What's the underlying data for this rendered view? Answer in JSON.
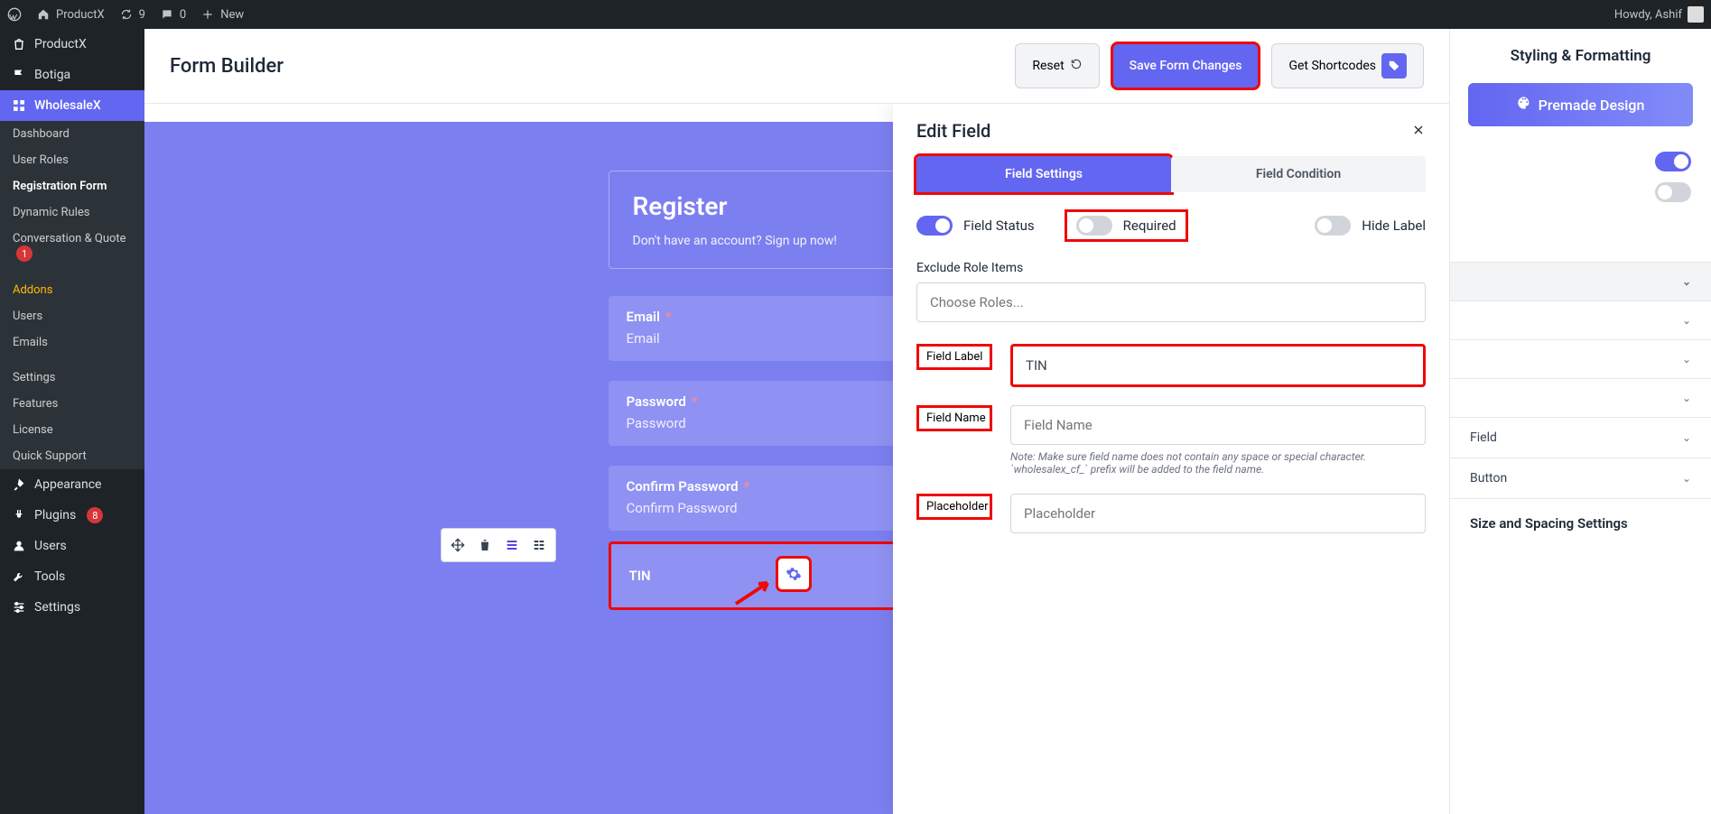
{
  "admin_bar": {
    "site_name": "ProductX",
    "updates": "9",
    "comments": "0",
    "new": "New",
    "howdy": "Howdy, Ashif"
  },
  "sidebar": {
    "top1": "ProductX",
    "top2": "Botiga",
    "active": "WholesaleX",
    "sub": {
      "dashboard": "Dashboard",
      "roles": "User Roles",
      "reg": "Registration Form",
      "rules": "Dynamic Rules",
      "conv": "Conversation & Quote",
      "conv_badge": "1",
      "addons": "Addons",
      "users": "Users",
      "emails": "Emails",
      "settings": "Settings",
      "features": "Features",
      "license": "License",
      "support": "Quick Support"
    },
    "bottom": {
      "appearance": "Appearance",
      "plugins": "Plugins",
      "plugins_badge": "8",
      "users": "Users",
      "tools": "Tools",
      "settings": "Settings"
    }
  },
  "header": {
    "title": "Form Builder",
    "reset": "Reset",
    "save": "Save Form Changes",
    "shortcodes": "Get Shortcodes"
  },
  "form": {
    "title": "Register",
    "subtitle": "Don't have an account? Sign up now!",
    "fields": {
      "email_label": "Email",
      "email_ph": "Email",
      "pw_label": "Password",
      "pw_ph": "Password",
      "cpw_label": "Confirm Password",
      "cpw_ph": "Confirm Password",
      "tin_label": "TIN"
    }
  },
  "edit_panel": {
    "title": "Edit Field",
    "tab1": "Field Settings",
    "tab2": "Field Condition",
    "t_status": "Field Status",
    "t_required": "Required",
    "t_hide": "Hide Label",
    "exclude": "Exclude Role Items",
    "choose_ph": "Choose Roles...",
    "fld_label": "Field Label",
    "fld_label_val": "TIN",
    "fld_name": "Field Name",
    "fld_name_ph": "Field Name",
    "fld_note": "Note: Make sure field name does not contain any space or special character. `wholesalex_cf_` prefix will be added to the field name.",
    "placeholder": "Placeholder",
    "placeholder_ph": "Placeholder"
  },
  "right_panel": {
    "title": "Styling & Formatting",
    "premade": "Premade Design",
    "items": {
      "field": "Field",
      "button": "Button"
    },
    "size_section": "Size and Spacing Settings"
  }
}
